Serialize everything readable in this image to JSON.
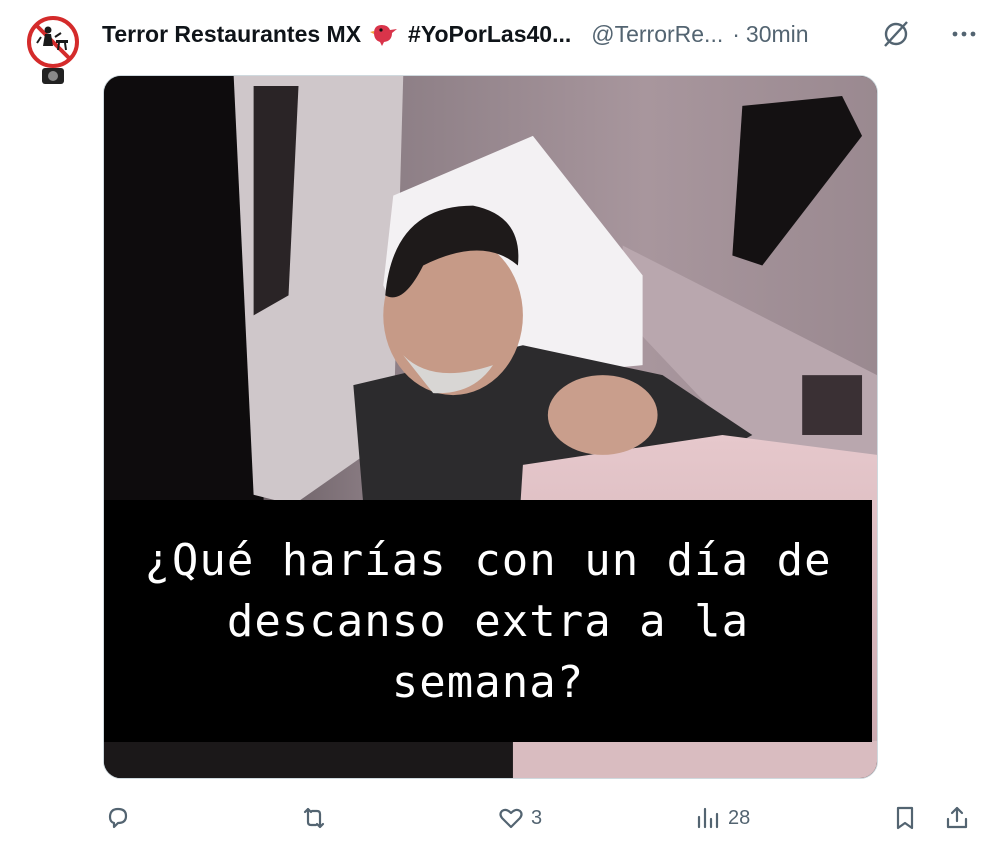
{
  "tweet": {
    "display_name": "Terror Restaurantes MX",
    "hashtag": "#YoPorLas40...",
    "handle": "@TerrorRe...",
    "separator": "·",
    "time": "30min",
    "avatar_icon": "no-dining-sign-avatar",
    "name_emoji": "red-bird-emoji",
    "caption": "¿Qué harías con un día de descanso extra a la semana?"
  },
  "actions": {
    "reply": {
      "icon": "reply-icon",
      "count": ""
    },
    "retweet": {
      "icon": "retweet-icon",
      "count": ""
    },
    "like": {
      "icon": "heart-icon",
      "count": "3"
    },
    "views": {
      "icon": "views-icon",
      "count": "28"
    },
    "bookmark": {
      "icon": "bookmark-icon"
    },
    "share": {
      "icon": "share-icon"
    }
  },
  "colors": {
    "text_primary": "#0f1419",
    "text_secondary": "#536471",
    "border": "#cfd9de",
    "bird_red": "#d9344a"
  }
}
